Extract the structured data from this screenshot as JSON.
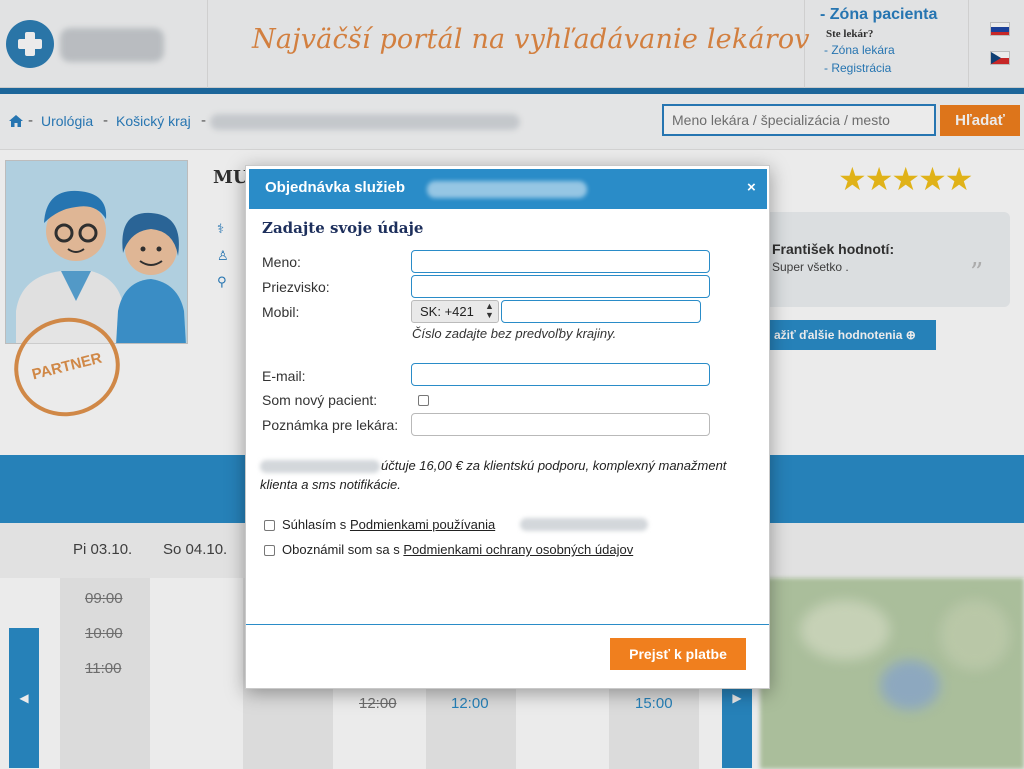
{
  "header": {
    "slogan": "Najväčší portál na vyhľadávanie lekárov",
    "patient_zone": "- Zóna pacienta",
    "doctor_question": "Ste lekár?",
    "doctor_zone": "- Zóna lekára",
    "registration": "- Registrácia",
    "flags": [
      "slovak-flag",
      "czech-flag"
    ]
  },
  "breadcrumb": {
    "items": [
      "Urológia",
      "Košický kraj"
    ],
    "separator": "-"
  },
  "search": {
    "placeholder": "Meno lekára / špecializácia / mesto",
    "button_label": "Hľadať"
  },
  "profile": {
    "name_prefix": "MU",
    "badge_text": "PARTNER",
    "rating_stars": 5
  },
  "review": {
    "author": "František hodnotí:",
    "text": "Super všetko .",
    "more_label": "ažiť ďalšie hodnotenia ⊕"
  },
  "calendar": {
    "days": [
      "Pi 03.10.",
      "So 04.10."
    ],
    "times_struck": [
      "09:00",
      "10:00",
      "11:00",
      "12:00"
    ],
    "times_free": [
      "12:00",
      "15:00"
    ]
  },
  "modal": {
    "title": "Objednávka služieb",
    "close": "×",
    "heading": "Zadajte svoje údaje",
    "fields": {
      "first_name_label": "Meno:",
      "last_name_label": "Priezvisko:",
      "mobile_label": "Mobil:",
      "country_code": "SK: +421",
      "mobile_hint": "Číslo zadajte bez predvoľby krajiny.",
      "email_label": "E-mail:",
      "new_patient_label": "Som nový pacient:",
      "note_label": "Poznámka pre lekára:"
    },
    "fee_line1": "účtuje 16,00 € za klientskú podporu, komplexný manažment",
    "fee_line2": "klienta a sms notifikácie.",
    "terms_prefix": "Súhlasím s",
    "terms_link": "Podmienkami používania",
    "privacy_prefix": "Oboznámil som sa s",
    "privacy_link": "Podmienkami ochrany osobných údajov",
    "submit_label": "Prejsť k platbe"
  },
  "colors": {
    "primary_blue": "#2a8cc8",
    "accent_orange": "#f07f1e",
    "slogan_orange": "#e48a45"
  }
}
